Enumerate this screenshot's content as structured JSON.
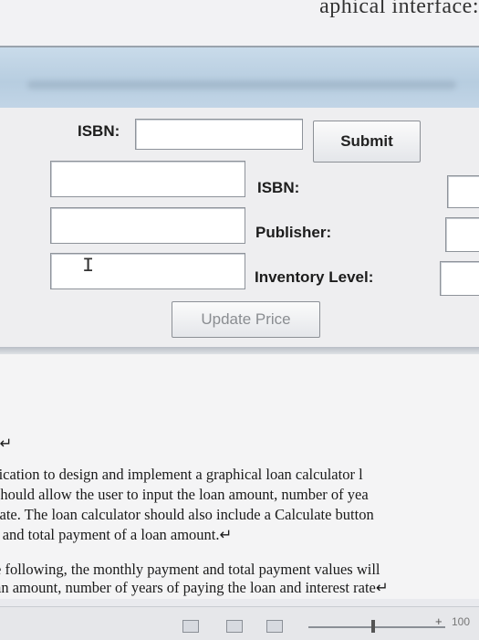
{
  "document_title_fragment": "aphical interface:",
  "form": {
    "isbn_search_label": "ISBN:",
    "isbn_search_value": "",
    "submit_label": "Submit",
    "result_isbn_label": "ISBN:",
    "result_isbn_value": "",
    "publisher_label": "Publisher:",
    "publisher_value": "",
    "inventory_label": "Inventory Level:",
    "inventory_value": "",
    "update_price_label": "Update Price"
  },
  "doc": {
    "marker": ")↵",
    "lines": [
      "lication to design and implement a graphical loan calculator l",
      "should allow the user to input the loan amount, number of yea",
      " rate. The loan calculator should also include a Calculate button",
      "t and total payment of a loan amount.↵"
    ],
    "lines2": [
      "e following, the monthly payment and total payment values will",
      "an amount, number of years of paying the loan and interest rate↵"
    ]
  },
  "statusbar": {
    "zoom_plus": "+",
    "zoom_level": "100"
  }
}
